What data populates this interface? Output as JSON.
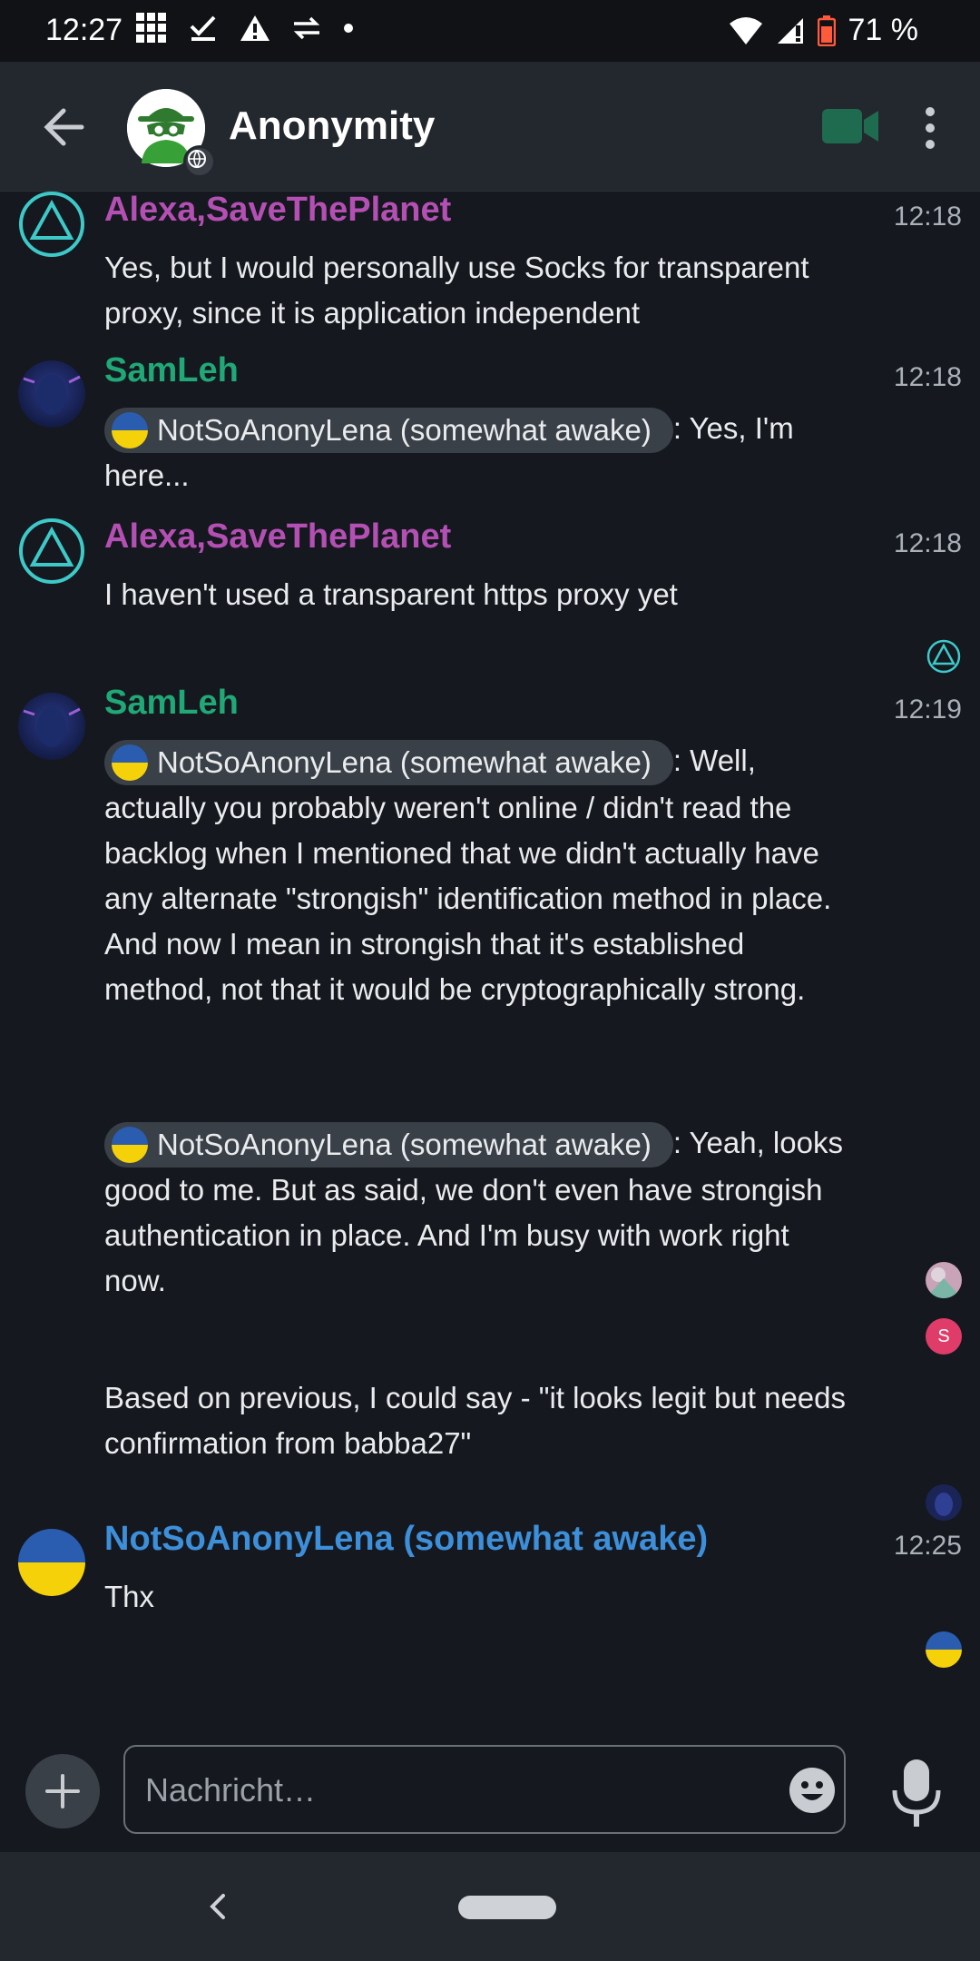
{
  "status_bar": {
    "time": "12:27",
    "battery": "71 %"
  },
  "header": {
    "room_name": "Anonymity"
  },
  "messages": [
    {
      "sender": "Alexa,SaveThePlanet",
      "time": "12:18",
      "text": "Yes, but I would personally use Socks for transparent proxy, since it is application independent"
    },
    {
      "sender": "SamLeh",
      "time": "12:18",
      "mention": "NotSoAnonyLena (somewhat awake)",
      "text": ": Yes, I'm here..."
    },
    {
      "sender": "Alexa,SaveThePlanet",
      "time": "12:18",
      "text": "I haven't used a transparent https proxy yet"
    },
    {
      "sender": "SamLeh",
      "time": "12:19",
      "mention": "NotSoAnonyLena (somewhat awake)",
      "text": ": Well, actually you probably weren't online / didn't read the backlog when I mentioned that we didn't actually have any alternate \"strongish\" identification method in place. And now I mean in strongish that it's established method, not that it would be cryptographically strong."
    },
    {
      "mention": "NotSoAnonyLena (somewhat awake)",
      "text": ": Yeah, looks good to me. But as said, we don't even have strongish authentication in place. And I'm busy with work right now."
    },
    {
      "text": "Based on previous, I could say - \"it looks legit but needs confirmation from babba27\""
    },
    {
      "sender": "NotSoAnonyLena (somewhat awake)",
      "time": "12:25",
      "text": "Thx"
    }
  ],
  "receipts": {
    "s_letter": "S"
  },
  "composer": {
    "placeholder": "Nachricht…"
  },
  "colors": {
    "alexa": "#b44fb4",
    "samleh": "#20a877",
    "lena": "#3d8fd9",
    "background": "#15181e",
    "topbar": "#23272e"
  }
}
